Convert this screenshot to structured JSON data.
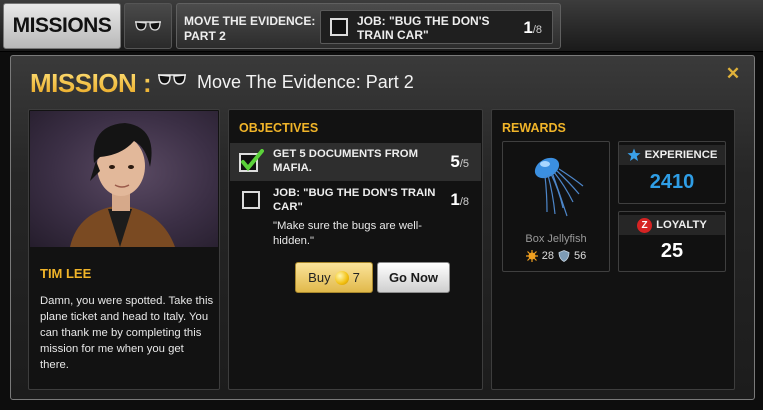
{
  "topbar": {
    "missions_tab": "MISSIONS",
    "glasses_icon": "sunglasses-icon",
    "current_mission_title": "MOVE THE EVIDENCE: PART 2",
    "current_job": {
      "text": "JOB: \"BUG THE DON'S TRAIN CAR\"",
      "progress": "1",
      "total": "/8"
    }
  },
  "header": {
    "label": "MISSION :",
    "icon": "sunglasses-icon",
    "mission_name": "Move The Evidence: Part 2",
    "close_icon": "close-x-icon"
  },
  "character": {
    "name": "TIM LEE",
    "message": "Damn, you were spotted. Take this plane ticket and head to Italy. You can thank me by completing this mission for me when you get there."
  },
  "objectives": {
    "title": "OBJECTIVES",
    "items": [
      {
        "text": "GET 5 DOCUMENTS FROM MAFIA.",
        "progress": "5",
        "total": "/5",
        "completed": true
      },
      {
        "text": "JOB: \"BUG THE DON'S TRAIN CAR\"",
        "progress": "1",
        "total": "/8",
        "completed": false,
        "description": "\"Make sure the bugs are well-hidden.\""
      }
    ],
    "buy_button": {
      "label": "Buy",
      "cost": "7",
      "icon": "gold-coin-icon"
    },
    "go_button": "Go Now"
  },
  "rewards": {
    "title": "REWARDS",
    "item": {
      "name": "Box Jellyfish",
      "attack": "28",
      "defense": "56"
    },
    "experience": {
      "label": "EXPERIENCE",
      "value": "2410",
      "icon": "star-icon"
    },
    "loyalty": {
      "label": "LOYALTY",
      "value": "25",
      "icon": "loyalty-z-icon"
    }
  },
  "colors": {
    "accent_gold": "#f0b429",
    "xp_blue": "#2f9ee6",
    "loyalty_red": "#d62323"
  }
}
